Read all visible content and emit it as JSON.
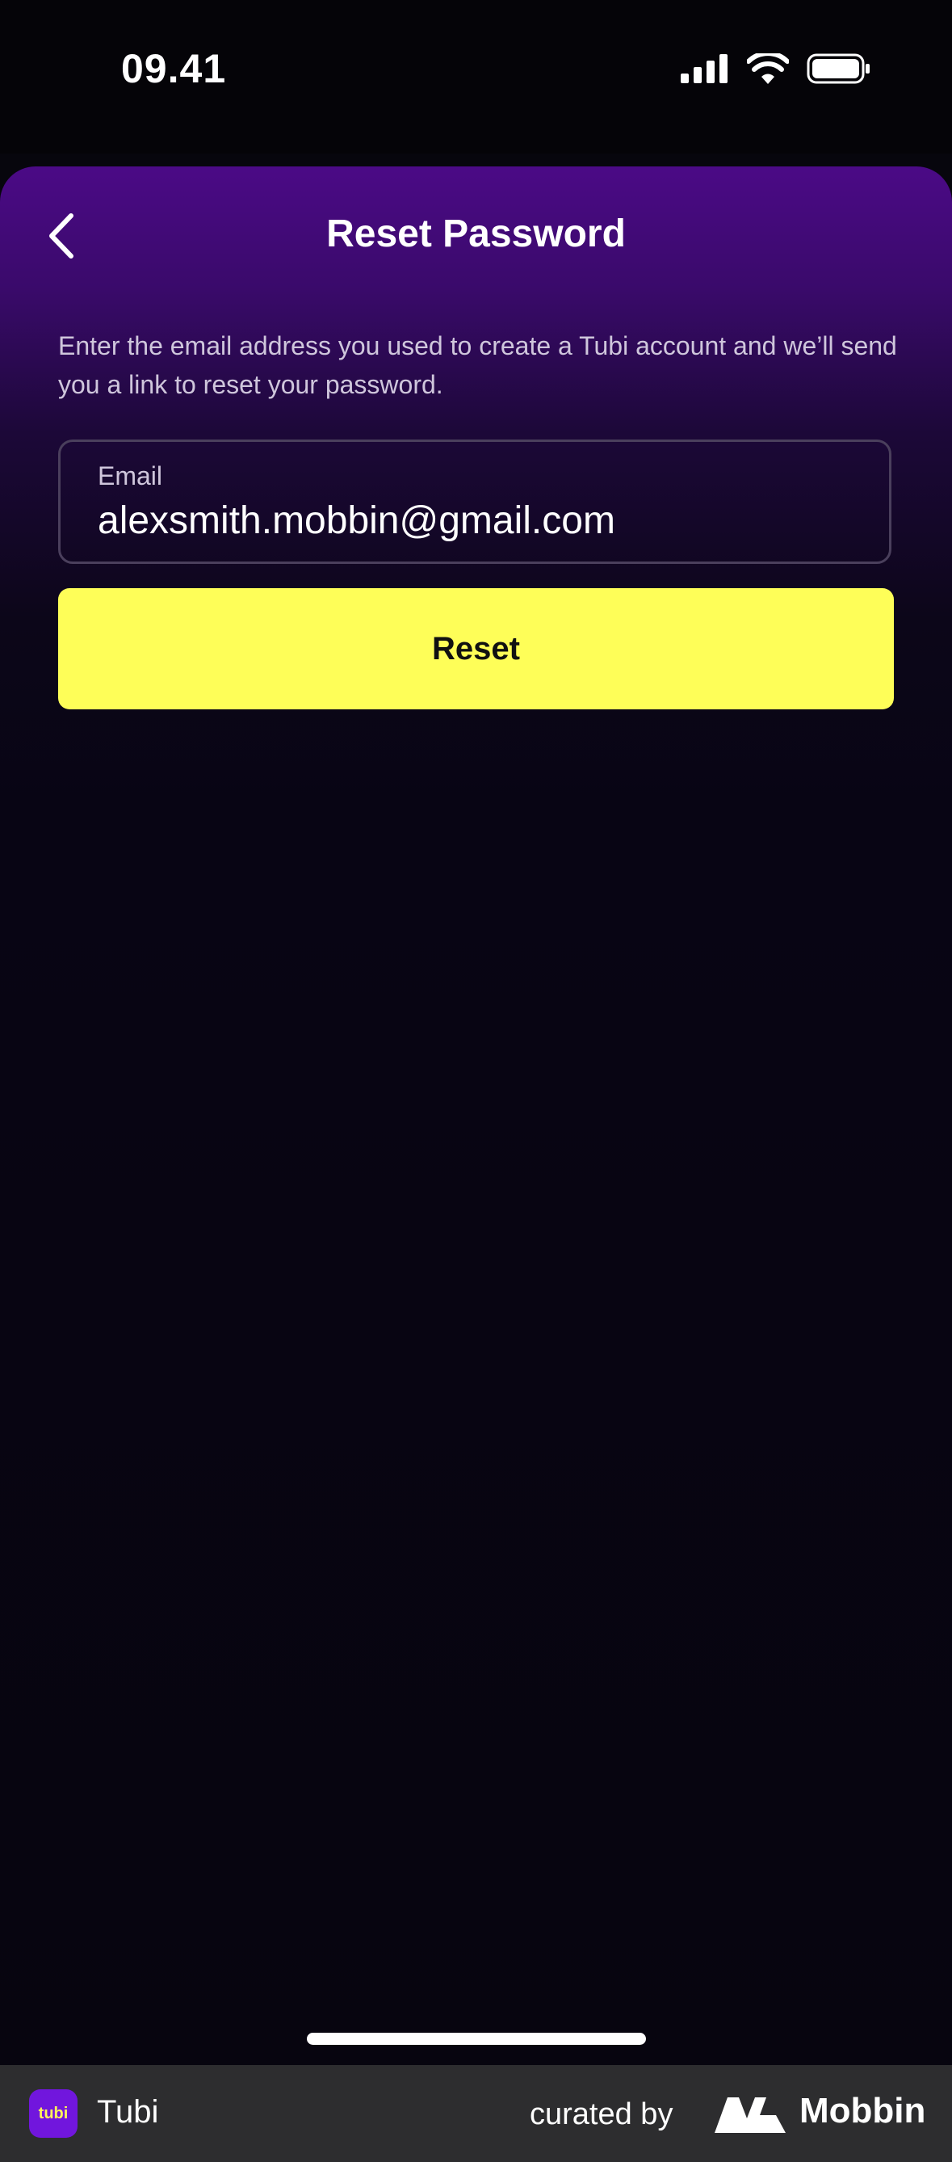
{
  "status_bar": {
    "time": "09.41",
    "icons": [
      "signal-icon",
      "wifi-icon",
      "battery-icon"
    ]
  },
  "header": {
    "back_icon": "chevron-left-icon",
    "title": "Reset Password"
  },
  "main": {
    "description": "Enter the email address you used to create a Tubi account and we’ll send you a link to reset your password.",
    "email_label": "Email",
    "email_value": "alexsmith.mobbin@gmail.com",
    "reset_label": "Reset"
  },
  "footer": {
    "app_logo_text": "tubi",
    "app_name": "Tubi",
    "curated_by": "curated by",
    "brand": "Mobbin"
  },
  "colors": {
    "accent_button": "#fefe58",
    "header_purple": "#4b0a86",
    "background": "#07060d"
  }
}
